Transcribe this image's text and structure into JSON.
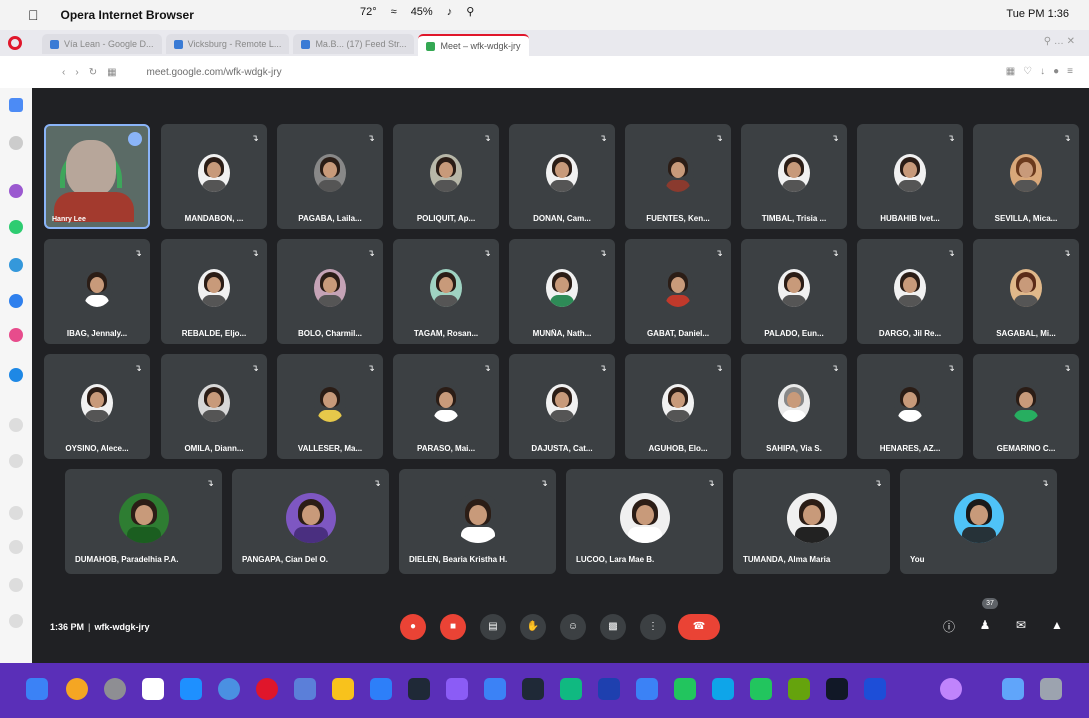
{
  "menubar": {
    "app_name": "Opera Internet Browser",
    "battery": "45%",
    "temp": "72°",
    "clock": "Tue PM 1:36"
  },
  "browser": {
    "tabs": [
      {
        "label": "Vía Lean - Google D..."
      },
      {
        "label": "Vicksburg - Remote L..."
      },
      {
        "label": "Ma.B... (17) Feed Str..."
      },
      {
        "label": "Meet – wfk-wdgk-jry"
      }
    ],
    "url": "meet.google.com/wfk-wdgk-jry"
  },
  "meet": {
    "meeting_time": "1:36 PM",
    "meeting_code": "wfk-wdgk-jry",
    "participant_count_badge": "37",
    "self_tile_name": "Hanry Lee",
    "rows": [
      [
        {
          "name": "MANDABON, ..."
        },
        {
          "name": "PAGABA, Laila..."
        },
        {
          "name": "POLIQUIT, Ap..."
        },
        {
          "name": "DONAN, Cam..."
        },
        {
          "name": "FUENTES, Ken..."
        },
        {
          "name": "TIMBAL, Trisia ..."
        },
        {
          "name": "HUBAHIB Ivet..."
        },
        {
          "name": "SEVILLA, Mica..."
        }
      ],
      [
        {
          "name": "IBAG, Jennaly..."
        },
        {
          "name": "REBALDE, Eljo..."
        },
        {
          "name": "BOLO, Charmil..."
        },
        {
          "name": "TAGAM, Rosan..."
        },
        {
          "name": "MUNÑA, Nath..."
        },
        {
          "name": "GABAT, Daniel..."
        },
        {
          "name": "PALADO, Eun..."
        },
        {
          "name": "DARGO, Jil Re..."
        },
        {
          "name": "SAGABAL, Mi..."
        }
      ],
      [
        {
          "name": "OYSINO, Alece..."
        },
        {
          "name": "OMILA, Diann..."
        },
        {
          "name": "VALLESER, Ma..."
        },
        {
          "name": "PARASO, Mai..."
        },
        {
          "name": "DAJUSTA, Cat..."
        },
        {
          "name": "AGUHOB, Elo..."
        },
        {
          "name": "SAHIPA, Via S."
        },
        {
          "name": "HENARES, AZ..."
        },
        {
          "name": "GEMARINO C..."
        }
      ],
      [
        {
          "name": "DUMAHOB, Paradelhia P.A."
        },
        {
          "name": "PANGAPA, Cian Del O."
        },
        {
          "name": "DIELEN, Bearia Kristha H."
        },
        {
          "name": "LUCOO, Lara Mae B."
        },
        {
          "name": "TUMANDA, Alma Maria"
        },
        {
          "name": "You"
        }
      ]
    ],
    "controls": {
      "mic": "mic-off",
      "camera": "camera-off",
      "captions": "captions",
      "hand": "raise-hand",
      "emoji": "emoji",
      "present": "present",
      "more": "more-options",
      "hangup": "leave-call"
    }
  }
}
